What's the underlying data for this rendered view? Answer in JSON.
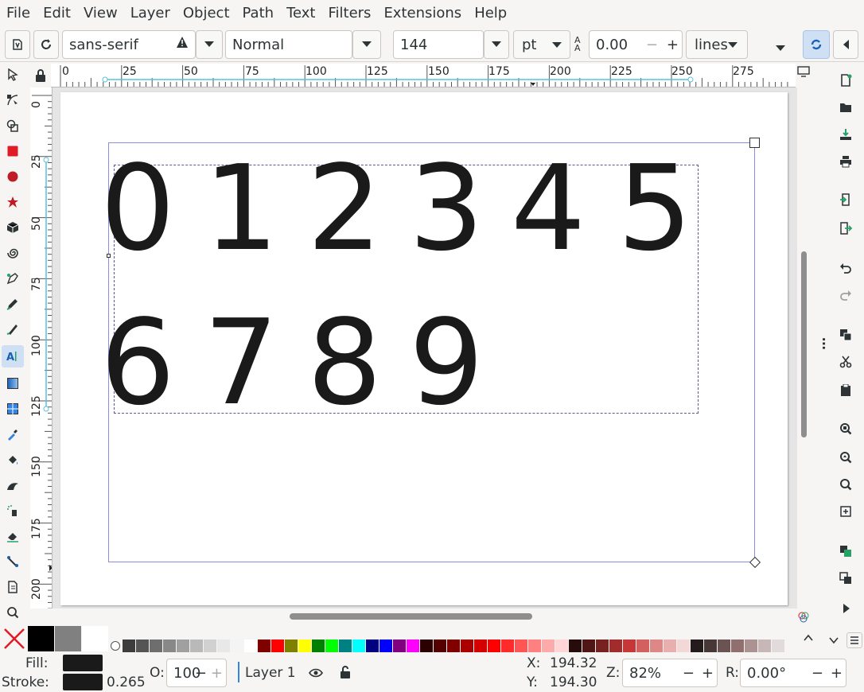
{
  "menu": [
    "File",
    "Edit",
    "View",
    "Layer",
    "Object",
    "Path",
    "Text",
    "Filters",
    "Extensions",
    "Help"
  ],
  "text_toolbar": {
    "font_family": "sans-serif",
    "font_style": "Normal",
    "font_size": "144",
    "unit": "pt",
    "letter_spacing": "0.00",
    "line_mode": "lines"
  },
  "ruler_h": [
    "0",
    "25",
    "50",
    "75",
    "100",
    "125",
    "150",
    "175",
    "200",
    "225",
    "250",
    "275"
  ],
  "ruler_v": [
    "0",
    "25",
    "50",
    "75",
    "100",
    "125",
    "150",
    "175",
    "200"
  ],
  "canvas_text": {
    "row1": [
      "0",
      "1",
      "2",
      "3",
      "4",
      "5"
    ],
    "row2": [
      "6",
      "7",
      "8",
      "9"
    ]
  },
  "status": {
    "fill_label": "Fill:",
    "stroke_label": "Stroke:",
    "stroke_width": "0.265",
    "opacity_label": "O:",
    "opacity": "100",
    "layer": "Layer 1",
    "x_label": "X:",
    "x": "194.32",
    "y_label": "Y:",
    "y": "194.30",
    "zoom_label": "Z:",
    "zoom": "82%",
    "rotation_label": "R:",
    "rotation": "0.00°"
  },
  "colors": {
    "accent": "#3584e4",
    "text_black": "#1a1a1a",
    "frame": "#8c8ce0"
  }
}
